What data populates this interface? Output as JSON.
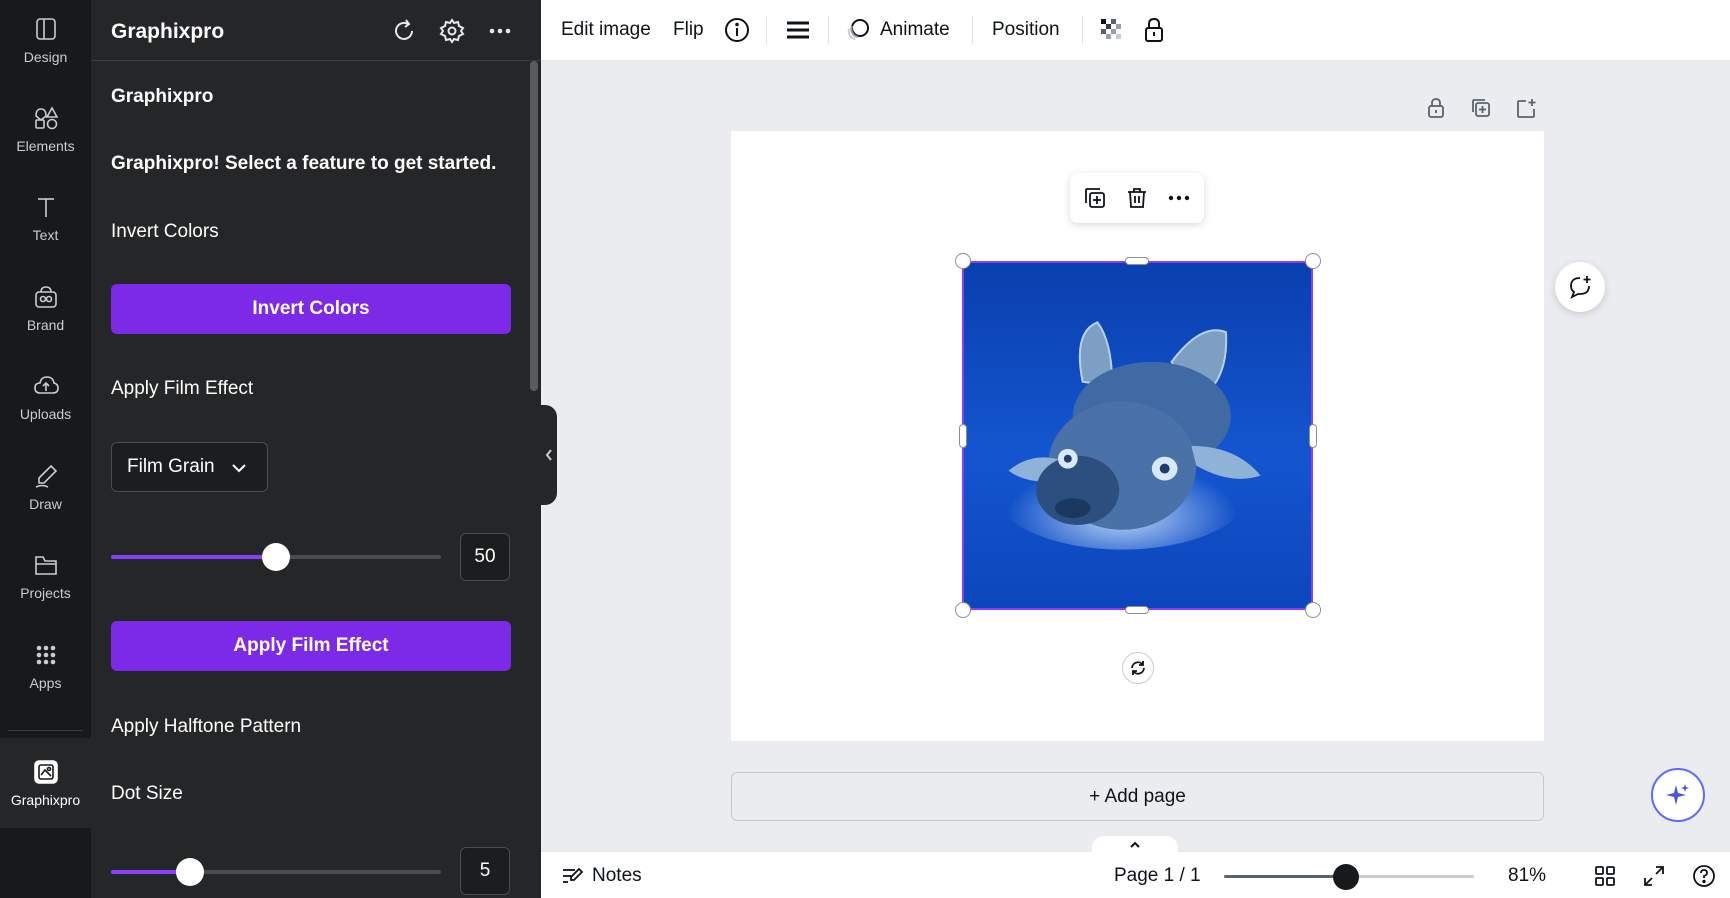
{
  "rail": {
    "items": [
      {
        "label": "Design",
        "icon": "design-icon"
      },
      {
        "label": "Elements",
        "icon": "elements-icon"
      },
      {
        "label": "Text",
        "icon": "text-icon"
      },
      {
        "label": "Brand",
        "icon": "brand-icon"
      },
      {
        "label": "Uploads",
        "icon": "uploads-icon"
      },
      {
        "label": "Draw",
        "icon": "draw-icon"
      },
      {
        "label": "Projects",
        "icon": "projects-icon"
      },
      {
        "label": "Apps",
        "icon": "apps-icon"
      },
      {
        "label": "Graphixpro",
        "icon": "graphixpro-icon",
        "active": true
      }
    ]
  },
  "panel": {
    "title": "Graphixpro",
    "subtitle": "Graphixpro",
    "intro": "Graphixpro! Select a feature to get started.",
    "invert": {
      "heading": "Invert Colors",
      "button": "Invert Colors"
    },
    "film": {
      "heading": "Apply Film Effect",
      "select_value": "Film Grain",
      "slider_value": "50",
      "slider_fraction": 0.5,
      "button": "Apply Film Effect"
    },
    "halftone": {
      "heading": "Apply Halftone Pattern",
      "dot_label": "Dot Size",
      "dot_value": "5",
      "dot_fraction": 0.24
    }
  },
  "toolbar": {
    "edit_image": "Edit image",
    "flip": "Flip",
    "animate": "Animate",
    "position": "Position"
  },
  "canvas": {
    "add_page": "+ Add page"
  },
  "bottombar": {
    "notes": "Notes",
    "page_indicator": "Page 1 / 1",
    "zoom": "81%",
    "zoom_fraction": 0.81
  },
  "colors": {
    "accent": "#7d2ae8",
    "selection": "#8b3dff",
    "rail_bg": "#18191b",
    "panel_bg": "#252627"
  }
}
